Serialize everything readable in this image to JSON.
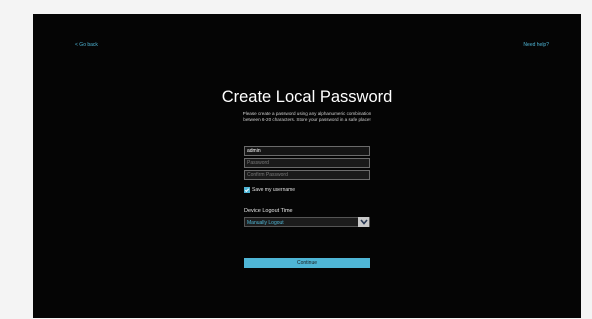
{
  "nav": {
    "back_label": "< Go back",
    "help_label": "Need help?"
  },
  "form": {
    "title": "Create Local Password",
    "subtitle_line1": "Please create a password using any alphanumeric combination",
    "subtitle_line2": "between 6-20 characters. Store your password in a safe place!",
    "username_value": "admin",
    "password_placeholder": "Password",
    "confirm_placeholder": "Confirm Password",
    "save_username_label": "Save my username",
    "save_username_checked": true,
    "logout_time_label": "Device Logout Time",
    "logout_time_value": "Manually Logout",
    "continue_label": "Continue"
  },
  "colors": {
    "accent": "#4fb6d6",
    "background": "#050505"
  },
  "icons": {
    "dropdown": "chevron-down-icon",
    "checkbox": "checkmark-icon"
  }
}
